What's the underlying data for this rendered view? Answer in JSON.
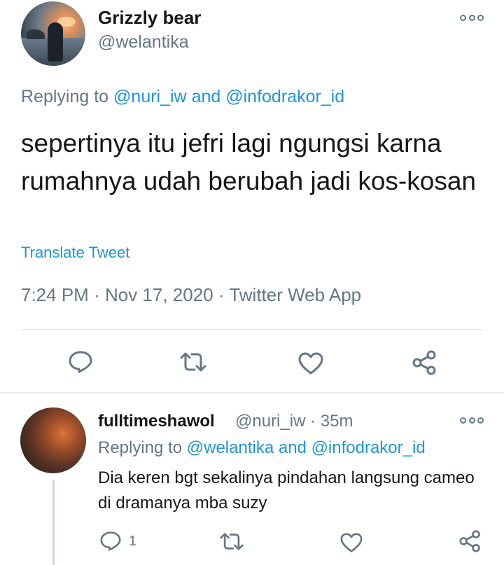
{
  "tweet": {
    "display_name": "Grizzly bear",
    "handle": "@welantika",
    "replying_prefix": "Replying to",
    "replying_user1": "@nuri_iw",
    "replying_and": "and",
    "replying_user2": "@infodrakor_id",
    "text": "sepertinya itu jefri lagi ngungsi karna rumahnya udah berubah jadi kos-kosan",
    "translate_label": "Translate Tweet",
    "time": "7:24 PM",
    "separator": "·",
    "date": "Nov 17, 2020",
    "source": "Twitter Web App",
    "actions": [
      "reply-icon",
      "retweet-icon",
      "like-icon",
      "share-icon"
    ]
  },
  "reply": {
    "display_name": "fulltimeshawol",
    "handle": "@nuri_iw",
    "separator": "·",
    "time_ago": "35m",
    "replying_prefix": "Replying to",
    "replying_user1": "@welantika",
    "replying_and": "and",
    "replying_user2": "@infodrakor_id",
    "text": "Dia keren bgt sekalinya pindahan langsung cameo di dramanya mba suzy",
    "reply_count": "1"
  },
  "colors": {
    "text": "#14171a",
    "secondary": "#657786",
    "link": "#1b95e0",
    "divider": "#e1e8ed"
  }
}
